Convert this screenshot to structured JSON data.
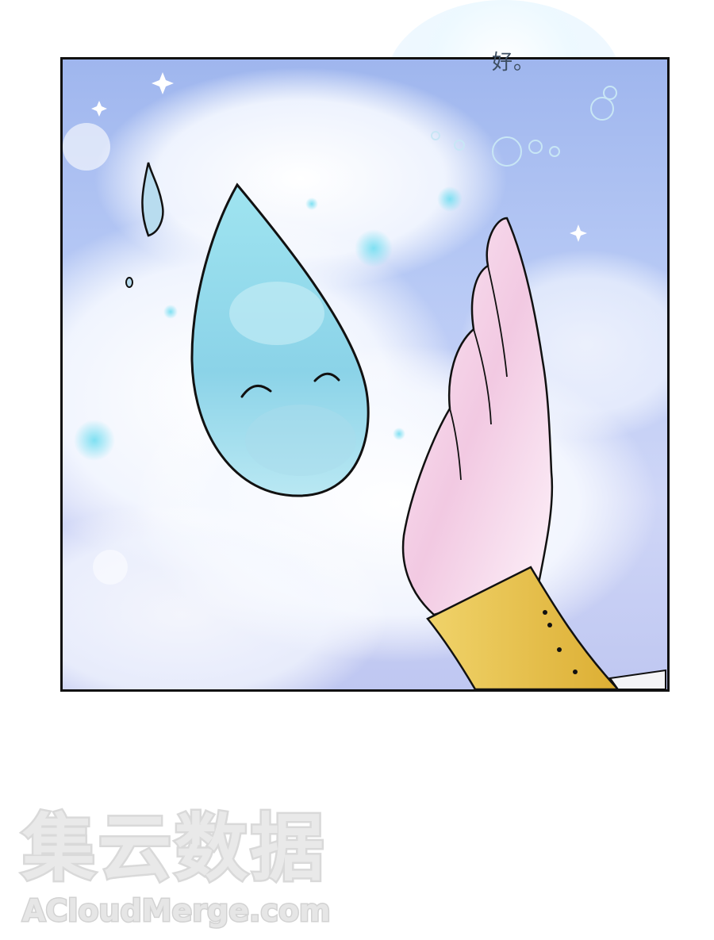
{
  "panel": {
    "speech_text": "好。"
  },
  "watermark": {
    "chinese": "集云数据",
    "latin": "ACloudMerge.com"
  },
  "colors": {
    "sky": "#a8bdf0",
    "droplet": "#8fd8ea",
    "hand": "#f2d0e6",
    "cuff": "#e7c04a",
    "border": "#111111"
  }
}
